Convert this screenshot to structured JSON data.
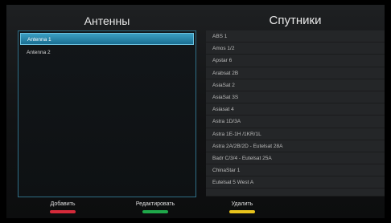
{
  "left_panel": {
    "title": "Антенны",
    "items": [
      {
        "label": "Antenna 1",
        "selected": true
      },
      {
        "label": "Antenna 2",
        "selected": false
      }
    ]
  },
  "right_panel": {
    "title": "Спутники",
    "items": [
      "ABS 1",
      "Amos 1/2",
      "Apstar 6",
      "Arabsat 2B",
      "AsiaSat 2",
      "AsiaSat 3S",
      "Asiasat 4",
      "Astra 1D/3A",
      "Astra 1E-1H /1KR/1L",
      "Astra 2A/2B/2D - Eutelsat 28A",
      "Badr C/3/4 - Eutelsat 25A",
      "ChinaStar 1",
      "Eutelsat 5 West A"
    ]
  },
  "footer": {
    "add": {
      "label": "Добавить",
      "color": "#d42a3a"
    },
    "edit": {
      "label": "Редактировать",
      "color": "#1fa84a"
    },
    "delete": {
      "label": "Удалить",
      "color": "#e8c31c"
    }
  }
}
